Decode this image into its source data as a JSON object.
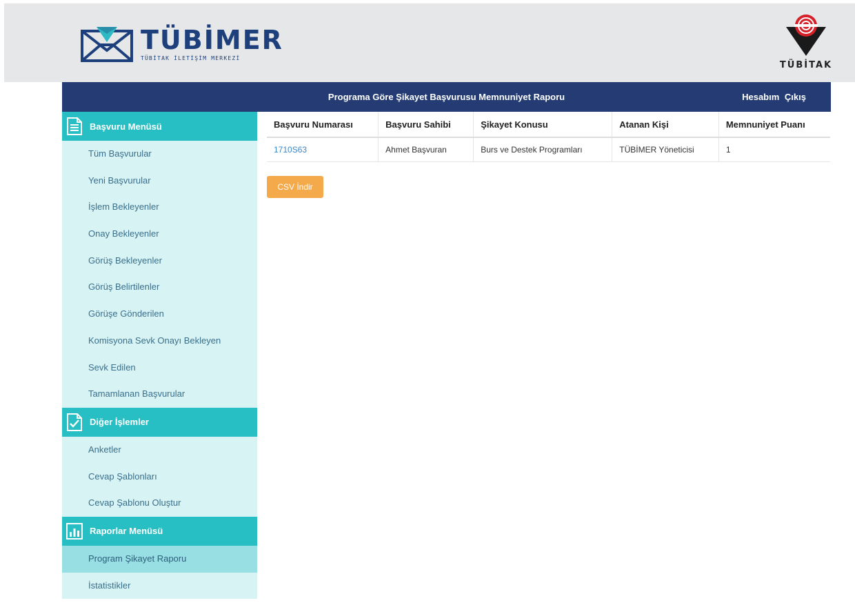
{
  "header": {
    "logo_title": "TÜBİMER",
    "logo_subtitle": "TÜBİTAK İLETİŞİM MERKEZİ",
    "partner_logo_text": "TÜBİTAK"
  },
  "title_bar": {
    "page_title": "Programa Göre Şikayet Başvurusu Memnuniyet Raporu",
    "account_link": "Hesabım",
    "logout_link": "Çıkış"
  },
  "sidebar": {
    "sections": [
      {
        "title": "Başvuru Menüsü",
        "icon": "document-icon",
        "items": [
          {
            "label": "Tüm Başvurular"
          },
          {
            "label": "Yeni Başvurular"
          },
          {
            "label": "İşlem Bekleyenler"
          },
          {
            "label": "Onay Bekleyenler"
          },
          {
            "label": "Görüş Bekleyenler"
          },
          {
            "label": "Görüş Belirtilenler"
          },
          {
            "label": "Görüşe Gönderilen"
          },
          {
            "label": "Komisyona Sevk Onayı Bekleyen"
          },
          {
            "label": "Sevk Edilen"
          },
          {
            "label": "Tamamlanan Başvurular"
          }
        ]
      },
      {
        "title": "Diğer İşlemler",
        "icon": "checklist-icon",
        "items": [
          {
            "label": "Anketler"
          },
          {
            "label": "Cevap Şablonları"
          },
          {
            "label": "Cevap Şablonu Oluştur"
          }
        ]
      },
      {
        "title": "Raporlar Menüsü",
        "icon": "bar-chart-icon",
        "items": [
          {
            "label": "Program Şikayet Raporu",
            "active": true
          },
          {
            "label": "İstatistikler"
          }
        ]
      }
    ]
  },
  "table": {
    "columns": [
      "Başvuru Numarası",
      "Başvuru Sahibi",
      "Şikayet Konusu",
      "Atanan Kişi",
      "Memnuniyet Puanı"
    ],
    "rows": [
      [
        "1710S63",
        "Ahmet Başvuran",
        "Burs ve Destek Programları",
        "TÜBİMER Yöneticisi",
        "1"
      ]
    ]
  },
  "actions": {
    "csv_button": "CSV İndir"
  },
  "colors": {
    "header_bg": "#e6e7e9",
    "title_bar_bg": "#243c73",
    "section_bg": "#27bfc3",
    "sidebar_bg": "#d7f3f4",
    "active_item_bg": "#97dfe2",
    "csv_button_bg": "#f4a94a",
    "link_color": "#3a86c9"
  }
}
